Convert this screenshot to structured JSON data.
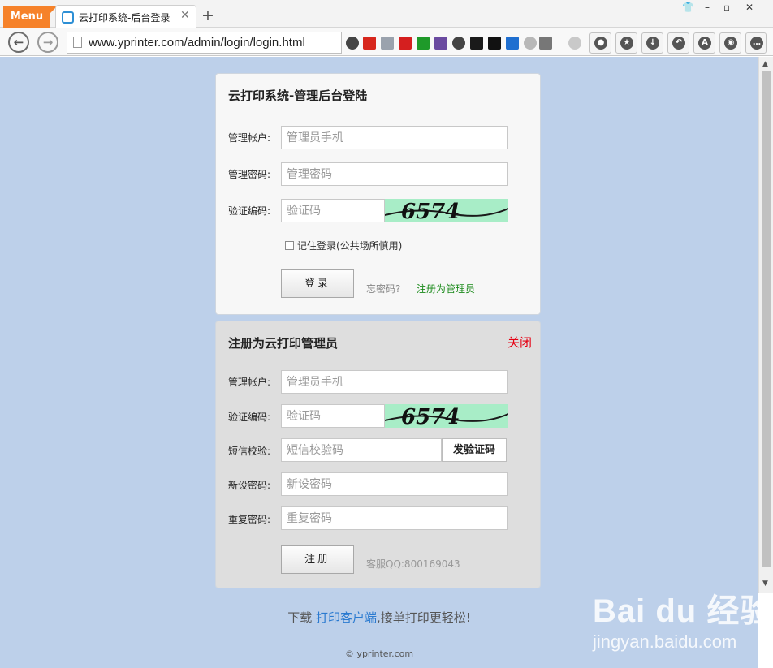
{
  "browser": {
    "menu_label": "Menu",
    "tab_title": "云打印系统-后台登录",
    "tab_close": "✕",
    "new_tab": "+",
    "url": "www.yprinter.com/admin/login/login.html",
    "window_controls": [
      "👕",
      "–",
      "▫",
      "✕"
    ],
    "toolbar_icons": [
      "lock-icon",
      "star-icon",
      "download-icon",
      "undo-icon",
      "font-icon",
      "wechat-icon",
      "more-icon"
    ]
  },
  "login": {
    "title": "云打印系统-管理后台登陆",
    "account_label": "管理帐户:",
    "account_placeholder": "管理员手机",
    "password_label": "管理密码:",
    "password_placeholder": "管理密码",
    "captcha_label": "验证编码:",
    "captcha_placeholder": "验证码",
    "captcha_text": "6574",
    "remember_label": "记住登录(公共场所慎用)",
    "submit_label": "登录",
    "forgot_label": "忘密码?",
    "register_link": "注册为管理员"
  },
  "register": {
    "title": "注册为云打印管理员",
    "close_label": "关闭",
    "account_label": "管理帐户:",
    "account_placeholder": "管理员手机",
    "captcha_label": "验证编码:",
    "captcha_placeholder": "验证码",
    "captcha_text": "6574",
    "sms_label": "短信校验:",
    "sms_placeholder": "短信校验码",
    "sms_button": "发验证码",
    "new_password_label": "新设密码:",
    "new_password_placeholder": "新设密码",
    "repeat_password_label": "重复密码:",
    "repeat_password_placeholder": "重复密码",
    "submit_label": "注册",
    "service_qq": "客服QQ:800169043"
  },
  "footer": {
    "download_prefix": "下载",
    "download_link": "打印客户端",
    "download_suffix": ",接单打印更轻松!",
    "copyright": "© yprinter.com"
  },
  "watermark": {
    "logo": "Bai du 经验",
    "sub": "jingyan.baidu.com"
  },
  "colors": {
    "background": "#bdd0ea",
    "menu": "#f6822a",
    "close": "#e60012",
    "register_link": "#1a8a1a",
    "download_link": "#2a7ad0"
  }
}
